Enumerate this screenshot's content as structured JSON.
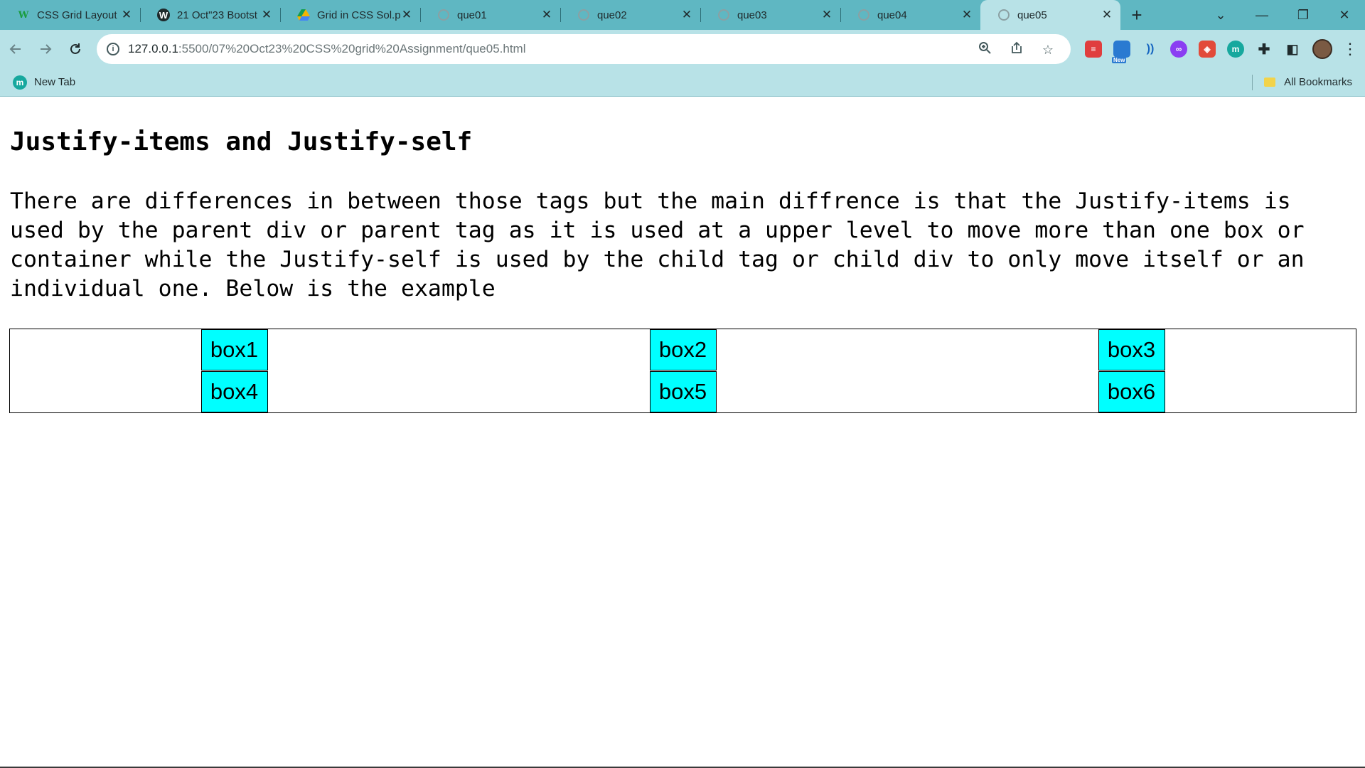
{
  "browser": {
    "tabs": [
      {
        "title": "CSS Grid Layout",
        "icon": "w-icon",
        "active": false
      },
      {
        "title": "21 Oct\"23 Bootst",
        "icon": "wordpress-icon",
        "active": false
      },
      {
        "title": "Grid in CSS Sol.p",
        "icon": "google-drive-icon",
        "active": false
      },
      {
        "title": "que01",
        "icon": "globe-icon",
        "active": false
      },
      {
        "title": "que02",
        "icon": "globe-icon",
        "active": false
      },
      {
        "title": "que03",
        "icon": "globe-icon",
        "active": false
      },
      {
        "title": "que04",
        "icon": "globe-icon",
        "active": false
      },
      {
        "title": "que05",
        "icon": "globe-icon",
        "active": true
      }
    ],
    "new_tab_glyph": "+",
    "window_controls": {
      "tab_search": "⌄",
      "minimize": "—",
      "restore": "❐",
      "close": "✕"
    },
    "address_bar": {
      "url_host": "127.0.0.1",
      "url_rest": ":5500/07%20Oct23%20CSS%20grid%20Assignment/que05.html"
    },
    "extension_badge": "New",
    "bookmarks": {
      "items": [
        {
          "label": "New Tab",
          "icon_letter": "m"
        }
      ],
      "all_bookmarks_label": "All Bookmarks"
    }
  },
  "page": {
    "heading": "Justify-items and Justify-self",
    "paragraph": "There are differences in between those tags but the main diffrence is that the Justify-items is used by the parent div or parent tag as it is used at a upper level to move more than one box or container while the Justify-self is used by the child tag or child div to only move itself or an individual one. Below is the example",
    "boxes": [
      "box1",
      "box2",
      "box3",
      "box4",
      "box5",
      "box6"
    ]
  },
  "colors": {
    "tab_strip": "#5fb7c2",
    "toolbar": "#b8e2e7",
    "box_fill": "#00ffff"
  }
}
